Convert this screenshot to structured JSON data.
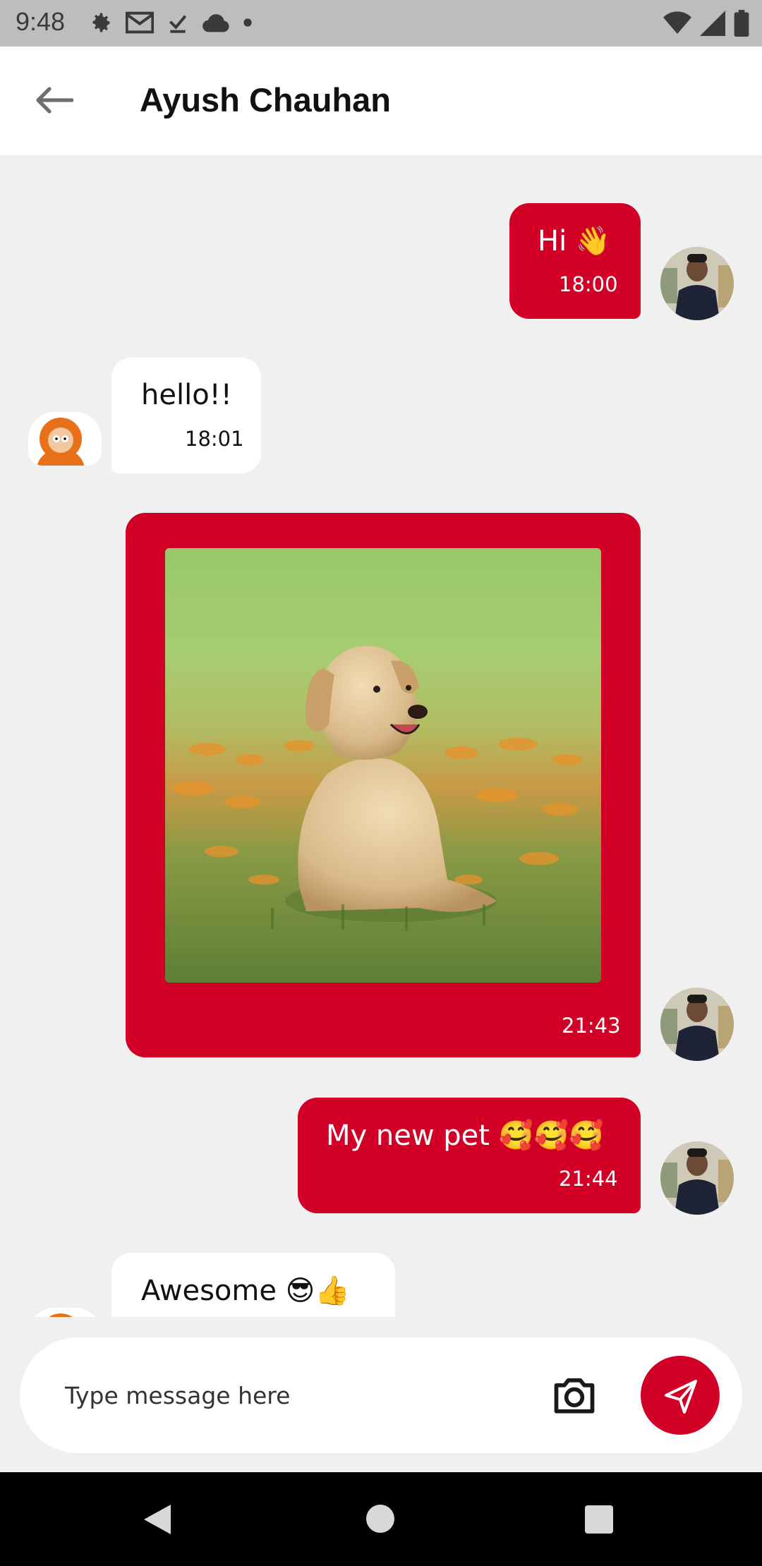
{
  "status_bar": {
    "time": "9:48",
    "left_icons": [
      "gear-icon",
      "gmail-icon",
      "download-done-icon",
      "cloud-icon",
      "dot-icon"
    ],
    "right_icons": [
      "wifi-icon",
      "signal-icon",
      "battery-icon"
    ]
  },
  "header": {
    "back_icon": "arrow-left-icon",
    "title": "Ayush Chauhan"
  },
  "colors": {
    "accent": "#d20027",
    "incoming_bubble": "#ffffff",
    "background": "#f0f0f0"
  },
  "messages": [
    {
      "direction": "outgoing",
      "type": "text",
      "text": "Hi 👋",
      "time": "18:00"
    },
    {
      "direction": "incoming",
      "type": "text",
      "text": "hello!!",
      "time": "18:01"
    },
    {
      "direction": "outgoing",
      "type": "image",
      "image_desc": "golden retriever puppy sitting on grass",
      "time": "21:43"
    },
    {
      "direction": "outgoing",
      "type": "text",
      "text": "My new pet 🥰🥰🥰",
      "time": "21:44"
    },
    {
      "direction": "incoming",
      "type": "text",
      "text": "Awesome 😎👍",
      "time": ""
    }
  ],
  "composer": {
    "placeholder": "Type message here",
    "camera_icon": "camera-icon",
    "send_icon": "send-icon"
  },
  "nav_bar": {
    "icons": [
      "nav-back-icon",
      "nav-home-icon",
      "nav-recents-icon"
    ]
  }
}
